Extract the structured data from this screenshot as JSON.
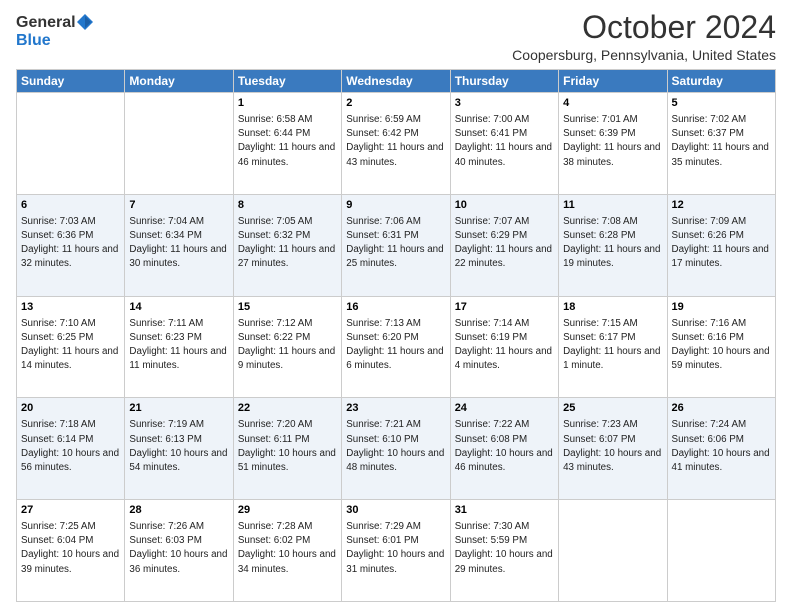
{
  "logo": {
    "general": "General",
    "blue": "Blue"
  },
  "title": "October 2024",
  "subtitle": "Coopersburg, Pennsylvania, United States",
  "days_of_week": [
    "Sunday",
    "Monday",
    "Tuesday",
    "Wednesday",
    "Thursday",
    "Friday",
    "Saturday"
  ],
  "weeks": [
    [
      {
        "day": "",
        "sunrise": "",
        "sunset": "",
        "daylight": ""
      },
      {
        "day": "",
        "sunrise": "",
        "sunset": "",
        "daylight": ""
      },
      {
        "day": "1",
        "sunrise": "Sunrise: 6:58 AM",
        "sunset": "Sunset: 6:44 PM",
        "daylight": "Daylight: 11 hours and 46 minutes."
      },
      {
        "day": "2",
        "sunrise": "Sunrise: 6:59 AM",
        "sunset": "Sunset: 6:42 PM",
        "daylight": "Daylight: 11 hours and 43 minutes."
      },
      {
        "day": "3",
        "sunrise": "Sunrise: 7:00 AM",
        "sunset": "Sunset: 6:41 PM",
        "daylight": "Daylight: 11 hours and 40 minutes."
      },
      {
        "day": "4",
        "sunrise": "Sunrise: 7:01 AM",
        "sunset": "Sunset: 6:39 PM",
        "daylight": "Daylight: 11 hours and 38 minutes."
      },
      {
        "day": "5",
        "sunrise": "Sunrise: 7:02 AM",
        "sunset": "Sunset: 6:37 PM",
        "daylight": "Daylight: 11 hours and 35 minutes."
      }
    ],
    [
      {
        "day": "6",
        "sunrise": "Sunrise: 7:03 AM",
        "sunset": "Sunset: 6:36 PM",
        "daylight": "Daylight: 11 hours and 32 minutes."
      },
      {
        "day": "7",
        "sunrise": "Sunrise: 7:04 AM",
        "sunset": "Sunset: 6:34 PM",
        "daylight": "Daylight: 11 hours and 30 minutes."
      },
      {
        "day": "8",
        "sunrise": "Sunrise: 7:05 AM",
        "sunset": "Sunset: 6:32 PM",
        "daylight": "Daylight: 11 hours and 27 minutes."
      },
      {
        "day": "9",
        "sunrise": "Sunrise: 7:06 AM",
        "sunset": "Sunset: 6:31 PM",
        "daylight": "Daylight: 11 hours and 25 minutes."
      },
      {
        "day": "10",
        "sunrise": "Sunrise: 7:07 AM",
        "sunset": "Sunset: 6:29 PM",
        "daylight": "Daylight: 11 hours and 22 minutes."
      },
      {
        "day": "11",
        "sunrise": "Sunrise: 7:08 AM",
        "sunset": "Sunset: 6:28 PM",
        "daylight": "Daylight: 11 hours and 19 minutes."
      },
      {
        "day": "12",
        "sunrise": "Sunrise: 7:09 AM",
        "sunset": "Sunset: 6:26 PM",
        "daylight": "Daylight: 11 hours and 17 minutes."
      }
    ],
    [
      {
        "day": "13",
        "sunrise": "Sunrise: 7:10 AM",
        "sunset": "Sunset: 6:25 PM",
        "daylight": "Daylight: 11 hours and 14 minutes."
      },
      {
        "day": "14",
        "sunrise": "Sunrise: 7:11 AM",
        "sunset": "Sunset: 6:23 PM",
        "daylight": "Daylight: 11 hours and 11 minutes."
      },
      {
        "day": "15",
        "sunrise": "Sunrise: 7:12 AM",
        "sunset": "Sunset: 6:22 PM",
        "daylight": "Daylight: 11 hours and 9 minutes."
      },
      {
        "day": "16",
        "sunrise": "Sunrise: 7:13 AM",
        "sunset": "Sunset: 6:20 PM",
        "daylight": "Daylight: 11 hours and 6 minutes."
      },
      {
        "day": "17",
        "sunrise": "Sunrise: 7:14 AM",
        "sunset": "Sunset: 6:19 PM",
        "daylight": "Daylight: 11 hours and 4 minutes."
      },
      {
        "day": "18",
        "sunrise": "Sunrise: 7:15 AM",
        "sunset": "Sunset: 6:17 PM",
        "daylight": "Daylight: 11 hours and 1 minute."
      },
      {
        "day": "19",
        "sunrise": "Sunrise: 7:16 AM",
        "sunset": "Sunset: 6:16 PM",
        "daylight": "Daylight: 10 hours and 59 minutes."
      }
    ],
    [
      {
        "day": "20",
        "sunrise": "Sunrise: 7:18 AM",
        "sunset": "Sunset: 6:14 PM",
        "daylight": "Daylight: 10 hours and 56 minutes."
      },
      {
        "day": "21",
        "sunrise": "Sunrise: 7:19 AM",
        "sunset": "Sunset: 6:13 PM",
        "daylight": "Daylight: 10 hours and 54 minutes."
      },
      {
        "day": "22",
        "sunrise": "Sunrise: 7:20 AM",
        "sunset": "Sunset: 6:11 PM",
        "daylight": "Daylight: 10 hours and 51 minutes."
      },
      {
        "day": "23",
        "sunrise": "Sunrise: 7:21 AM",
        "sunset": "Sunset: 6:10 PM",
        "daylight": "Daylight: 10 hours and 48 minutes."
      },
      {
        "day": "24",
        "sunrise": "Sunrise: 7:22 AM",
        "sunset": "Sunset: 6:08 PM",
        "daylight": "Daylight: 10 hours and 46 minutes."
      },
      {
        "day": "25",
        "sunrise": "Sunrise: 7:23 AM",
        "sunset": "Sunset: 6:07 PM",
        "daylight": "Daylight: 10 hours and 43 minutes."
      },
      {
        "day": "26",
        "sunrise": "Sunrise: 7:24 AM",
        "sunset": "Sunset: 6:06 PM",
        "daylight": "Daylight: 10 hours and 41 minutes."
      }
    ],
    [
      {
        "day": "27",
        "sunrise": "Sunrise: 7:25 AM",
        "sunset": "Sunset: 6:04 PM",
        "daylight": "Daylight: 10 hours and 39 minutes."
      },
      {
        "day": "28",
        "sunrise": "Sunrise: 7:26 AM",
        "sunset": "Sunset: 6:03 PM",
        "daylight": "Daylight: 10 hours and 36 minutes."
      },
      {
        "day": "29",
        "sunrise": "Sunrise: 7:28 AM",
        "sunset": "Sunset: 6:02 PM",
        "daylight": "Daylight: 10 hours and 34 minutes."
      },
      {
        "day": "30",
        "sunrise": "Sunrise: 7:29 AM",
        "sunset": "Sunset: 6:01 PM",
        "daylight": "Daylight: 10 hours and 31 minutes."
      },
      {
        "day": "31",
        "sunrise": "Sunrise: 7:30 AM",
        "sunset": "Sunset: 5:59 PM",
        "daylight": "Daylight: 10 hours and 29 minutes."
      },
      {
        "day": "",
        "sunrise": "",
        "sunset": "",
        "daylight": ""
      },
      {
        "day": "",
        "sunrise": "",
        "sunset": "",
        "daylight": ""
      }
    ]
  ]
}
